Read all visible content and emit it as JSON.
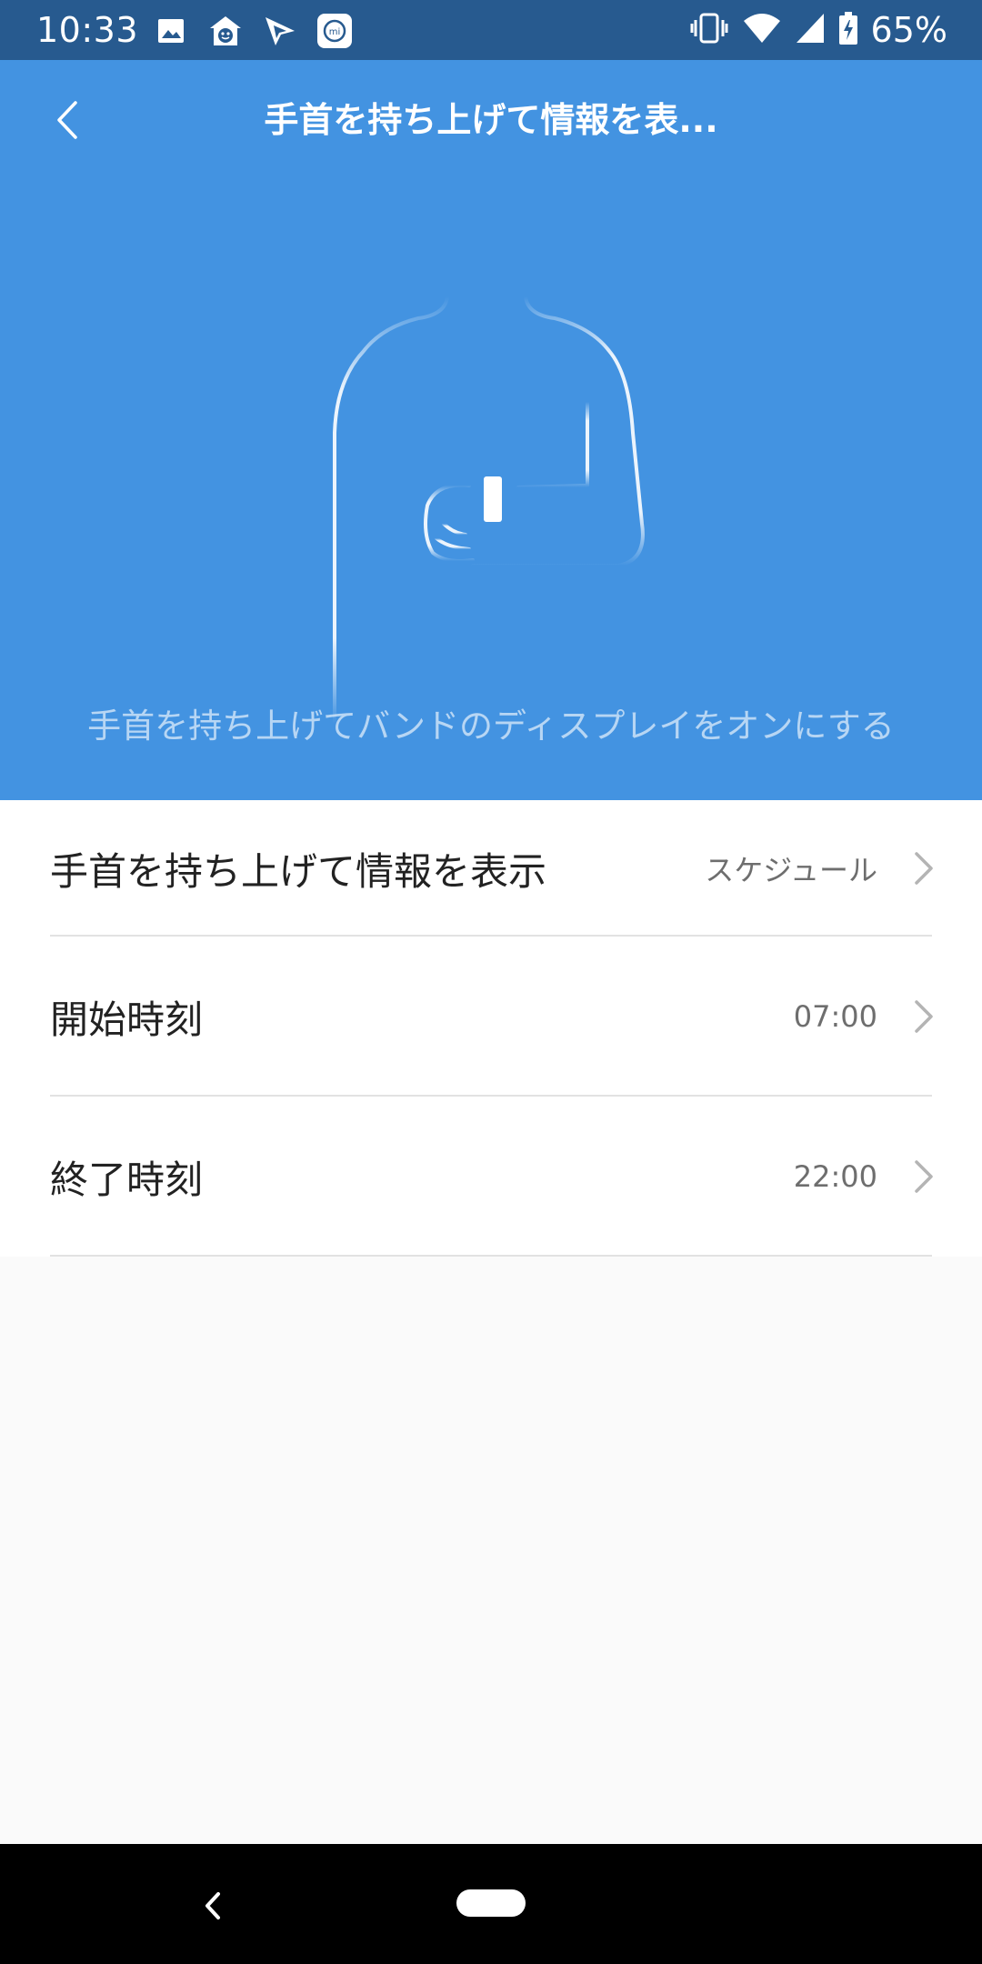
{
  "status_bar": {
    "time": "10:33",
    "left_icons": [
      "image-icon",
      "home-face-icon",
      "signal-app-icon",
      "mi-app-icon"
    ],
    "right_icons": [
      "vibrate-icon",
      "wifi-icon",
      "cell-signal-icon",
      "battery-charging-icon"
    ],
    "battery_percent": "65%",
    "background": "#275a8f"
  },
  "header": {
    "title": "手首を持ち上げて情報を表...",
    "back_icon": "chevron-left-icon",
    "background": "#4393e1"
  },
  "hero": {
    "illustration": "person-raising-wrist-with-band",
    "caption": "手首を持ち上げてバンドのディスプレイをオンにする"
  },
  "settings": {
    "items": [
      {
        "label": "手首を持ち上げて情報を表示",
        "value": "スケジュール"
      },
      {
        "label": "開始時刻",
        "value": "07:00"
      },
      {
        "label": "終了時刻",
        "value": "22:00"
      }
    ]
  },
  "nav_bar": {
    "back_icon": "nav-back-icon",
    "home_icon": "nav-home-pill-icon"
  }
}
